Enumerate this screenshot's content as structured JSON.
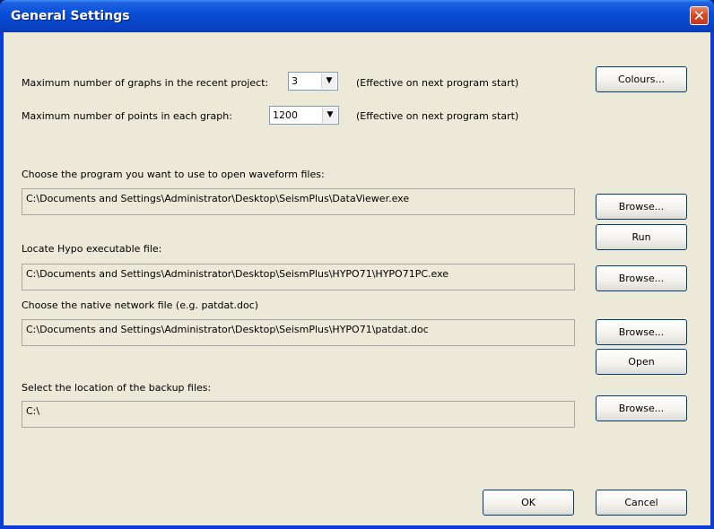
{
  "window": {
    "title": "General Settings",
    "close_label": "✕"
  },
  "graphs_setting": {
    "label": "Maximum number of graphs in the recent project:",
    "value": "3",
    "note": "(Effective on next program start)"
  },
  "points_setting": {
    "label": "Maximum number of points in each graph:",
    "value": "1200",
    "note": "(Effective on next program start)"
  },
  "colours_button": "Colours...",
  "waveform": {
    "label": "Choose the program you want to use to open waveform files:",
    "path": "C:\\Documents and Settings\\Administrator\\Desktop\\SeismPlus\\DataViewer.exe",
    "browse": "Browse...",
    "run": "Run"
  },
  "hypo": {
    "label": "Locate Hypo executable file:",
    "path": "C:\\Documents and Settings\\Administrator\\Desktop\\SeismPlus\\HYPO71\\HYPO71PC.exe",
    "browse": "Browse..."
  },
  "network": {
    "label": "Choose the native network file (e.g. patdat.doc)",
    "path": "C:\\Documents and Settings\\Administrator\\Desktop\\SeismPlus\\HYPO71\\patdat.doc",
    "browse": "Browse...",
    "open": "Open"
  },
  "backup": {
    "label": "Select the location of the backup files:",
    "path": "C:\\",
    "browse": "Browse..."
  },
  "footer": {
    "ok": "OK",
    "cancel": "Cancel"
  }
}
